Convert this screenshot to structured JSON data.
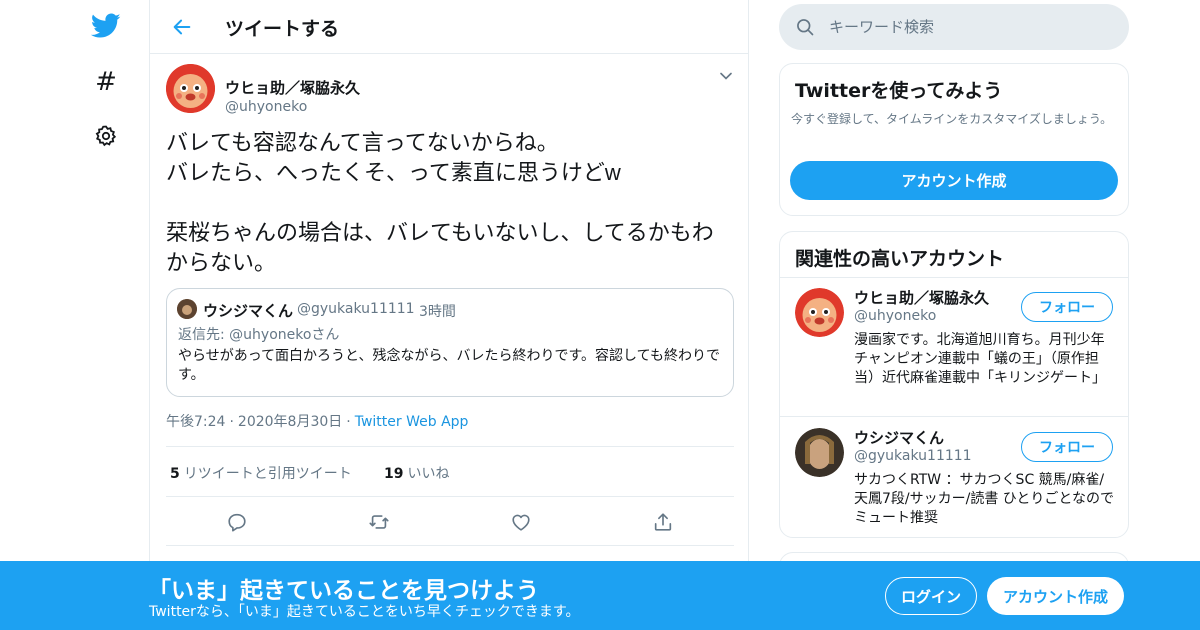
{
  "colors": {
    "accent": "#1da1f2",
    "link": "#1b95e0",
    "muted": "#657786",
    "text": "#14171a",
    "border": "#e6ecf0"
  },
  "nav": {
    "icons": [
      "twitter-bird-icon",
      "hashtag-icon",
      "gear-icon"
    ],
    "hashtag_glyph": "#"
  },
  "header": {
    "title": "ツイートする"
  },
  "tweet": {
    "author_name": "ウヒョ助／塚脇永久",
    "author_handle": "@uhyoneko",
    "text": "バレても容認なんて言ってないからね。\nバレたら、へったくそ、って素直に思うけどw\n\n栞桜ちゃんの場合は、バレてもいないし、してるかもわからない。",
    "quote": {
      "name": "ウシジマくん",
      "handle": "@gyukaku11111",
      "dot": "·",
      "time": "3時間",
      "reply_to": "返信先: @uhyonekoさん",
      "text": "やらせがあって面白かろうと、残念ながら、バレたら終わりです。容認しても終わりです。"
    },
    "time": "午後7:24",
    "date": "2020年8月30日",
    "separator": "·",
    "app": "Twitter Web App",
    "retweets_count": "5",
    "retweets_label": "リツイートと引用ツイート",
    "likes_count": "19",
    "likes_label": "いいね"
  },
  "search": {
    "placeholder": "キーワード検索"
  },
  "signup_card": {
    "title": "Twitterを使ってみよう",
    "description": "今すぐ登録して、タイムラインをカスタマイズしましょう。",
    "button": "アカウント作成"
  },
  "related": {
    "title": "関連性の高いアカウント",
    "accounts": [
      {
        "name": "ウヒョ助／塚脇永久",
        "handle": "@uhyoneko",
        "follow": "フォロー",
        "bio": "漫画家です。北海道旭川育ち。月刊少年チャンピオン連載中「蟻の王」（原作担当）近代麻雀連載中「キリンジゲート」"
      },
      {
        "name": "ウシジマくん",
        "handle": "@gyukaku11111",
        "follow": "フォロー",
        "bio": "サカつくRTW ：サカつくSC 競馬/麻雀/天鳳7段/サッカー/読書 ひとりごとなのでミュート推奨"
      }
    ]
  },
  "banner": {
    "title": "「いま」起きていることを見つけよう",
    "subtitle": "Twitterなら、「いま」起きていることをいち早くチェックできます。",
    "login": "ログイン",
    "signup": "アカウント作成"
  }
}
